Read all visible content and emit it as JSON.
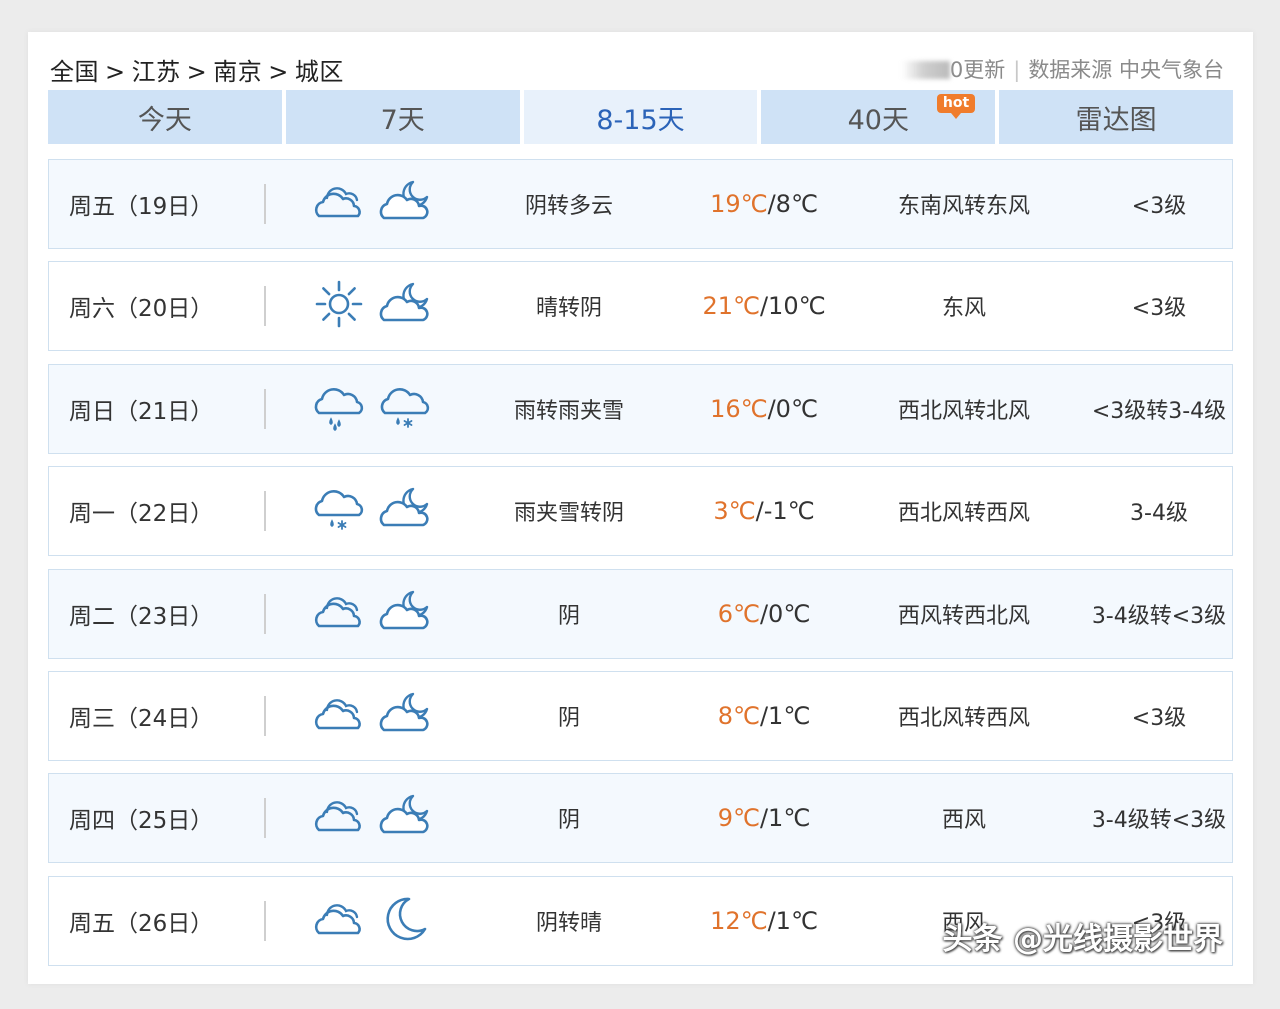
{
  "breadcrumb": [
    "全国",
    "江苏",
    "南京",
    "城区"
  ],
  "breadcrumb_sep": ">",
  "meta": {
    "update_suffix": "0更新",
    "source_label": "数据来源",
    "source_name": "中央气象台"
  },
  "tabs": [
    {
      "label": "今天",
      "active": false
    },
    {
      "label": "7天",
      "active": false
    },
    {
      "label": "8-15天",
      "active": true
    },
    {
      "label": "40天",
      "active": false,
      "badge": "hot"
    },
    {
      "label": "雷达图",
      "active": false
    }
  ],
  "forecast": [
    {
      "date": "周五（19日）",
      "day_icon": "cloudy-icon",
      "night_icon": "partly-cloudy-night-icon",
      "desc": "阴转多云",
      "high": "19℃",
      "low": "8℃",
      "wind": "东南风转东风",
      "level": "<3级"
    },
    {
      "date": "周六（20日）",
      "day_icon": "sunny-icon",
      "night_icon": "partly-cloudy-night-icon",
      "desc": "晴转阴",
      "high": "21℃",
      "low": "10℃",
      "wind": "东风",
      "level": "<3级"
    },
    {
      "date": "周日（21日）",
      "day_icon": "rain-icon",
      "night_icon": "sleet-icon",
      "desc": "雨转雨夹雪",
      "high": "16℃",
      "low": "0℃",
      "wind": "西北风转北风",
      "level": "<3级转3-4级"
    },
    {
      "date": "周一（22日）",
      "day_icon": "sleet-icon",
      "night_icon": "partly-cloudy-night-icon",
      "desc": "雨夹雪转阴",
      "high": "3℃",
      "low": "-1℃",
      "wind": "西北风转西风",
      "level": "3-4级"
    },
    {
      "date": "周二（23日）",
      "day_icon": "cloudy-icon",
      "night_icon": "partly-cloudy-night-icon",
      "desc": "阴",
      "high": "6℃",
      "low": "0℃",
      "wind": "西风转西北风",
      "level": "3-4级转<3级"
    },
    {
      "date": "周三（24日）",
      "day_icon": "cloudy-icon",
      "night_icon": "partly-cloudy-night-icon",
      "desc": "阴",
      "high": "8℃",
      "low": "1℃",
      "wind": "西北风转西风",
      "level": "<3级"
    },
    {
      "date": "周四（25日）",
      "day_icon": "cloudy-icon",
      "night_icon": "partly-cloudy-night-icon",
      "desc": "阴",
      "high": "9℃",
      "low": "1℃",
      "wind": "西风",
      "level": "3-4级转<3级"
    },
    {
      "date": "周五（26日）",
      "day_icon": "cloudy-icon",
      "night_icon": "moon-icon",
      "desc": "阴转晴",
      "high": "12℃",
      "low": "1℃",
      "wind": "西风",
      "level": "<3级"
    }
  ],
  "watermark": "头条 @光线摄影世界",
  "colors": {
    "tab_bg": "#cfe2f6",
    "tab_active_bg": "#e8f1fb",
    "tab_active_text": "#2b63b8",
    "high_temp": "#e0732c",
    "icon": "#3b7db6",
    "row_border": "#cfe0ef",
    "row_alt_bg": "#f4f9fe",
    "hot_badge": "#f07c2c"
  }
}
